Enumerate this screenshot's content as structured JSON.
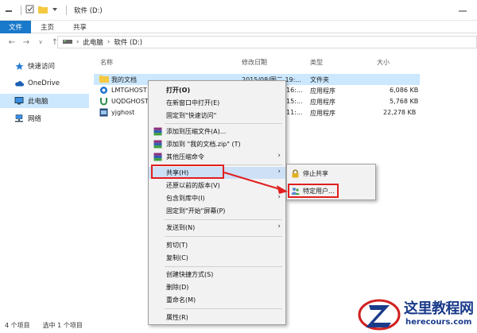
{
  "window": {
    "title": "软件 (D:)",
    "quick_access": [
      "minimize-pane-icon",
      "checkbox-icon",
      "folder-icon",
      "dropdown-icon"
    ]
  },
  "ribbon": {
    "tabs": [
      "文件",
      "主页",
      "共享"
    ]
  },
  "address_bar": {
    "segments": [
      "此电脑",
      "软件 (D:)"
    ]
  },
  "nav_pane": {
    "items": [
      {
        "label": "快速访问",
        "icon": "star-icon"
      },
      {
        "label": "OneDrive",
        "icon": "cloud-icon"
      },
      {
        "label": "此电脑",
        "icon": "computer-icon",
        "selected": true
      },
      {
        "label": "网络",
        "icon": "network-icon"
      }
    ]
  },
  "file_list": {
    "columns": [
      "名称",
      "修改日期",
      "类型",
      "大小"
    ],
    "rows": [
      {
        "name": "我的文档",
        "date": "2015/08/图二 19:...",
        "type": "文件夹",
        "size": "",
        "icon": "folder-icon",
        "selected": true
      },
      {
        "name": "LMTGHOST",
        "date": "16:...",
        "type": "应用程序",
        "size": "6,086 KB",
        "icon": "ghost-icon"
      },
      {
        "name": "UQDGHOST",
        "date": "15:...",
        "type": "应用程序",
        "size": "5,768 KB",
        "icon": "u-icon"
      },
      {
        "name": "yjghost",
        "date": "11:...",
        "type": "应用程序",
        "size": "22,278 KB",
        "icon": "app-icon"
      }
    ]
  },
  "context_menu": {
    "items": [
      {
        "label": "打开(O)",
        "bold": true
      },
      {
        "label": "在新窗口中打开(E)"
      },
      {
        "label": "固定到\"快速访问\""
      },
      {
        "label": "添加到压缩文件(A)...",
        "icon": "winrar-icon"
      },
      {
        "label": "添加到 \"我的文档.zip\" (T)",
        "icon": "winrar-icon"
      },
      {
        "label": "其他压缩命令",
        "icon": "winrar-icon",
        "submenu": true
      },
      {
        "label": "共享(H)",
        "submenu": true,
        "highlighted": true
      },
      {
        "label": "还原以前的版本(V)"
      },
      {
        "label": "包含到库中(I)",
        "submenu": true
      },
      {
        "label": "固定到\"开始\"屏幕(P)"
      },
      {
        "label": "发送到(N)",
        "submenu": true
      },
      {
        "label": "剪切(T)"
      },
      {
        "label": "复制(C)"
      },
      {
        "label": "创建快捷方式(S)"
      },
      {
        "label": "删除(D)"
      },
      {
        "label": "重命名(M)"
      },
      {
        "label": "属性(R)"
      }
    ]
  },
  "share_submenu": {
    "items": [
      {
        "label": "停止共享",
        "icon": "lock-icon"
      },
      {
        "label": "特定用户...",
        "icon": "users-icon"
      }
    ]
  },
  "status_bar": {
    "item_count": "4 个项目",
    "selected": "选中 1 个项目"
  },
  "watermark": {
    "title": "这里教程网",
    "url": "herecours.com"
  },
  "colors": {
    "accent": "#1979ca",
    "selection": "#cce8ff",
    "highlight_border": "#e02020",
    "watermark": "#1a3a8a"
  }
}
